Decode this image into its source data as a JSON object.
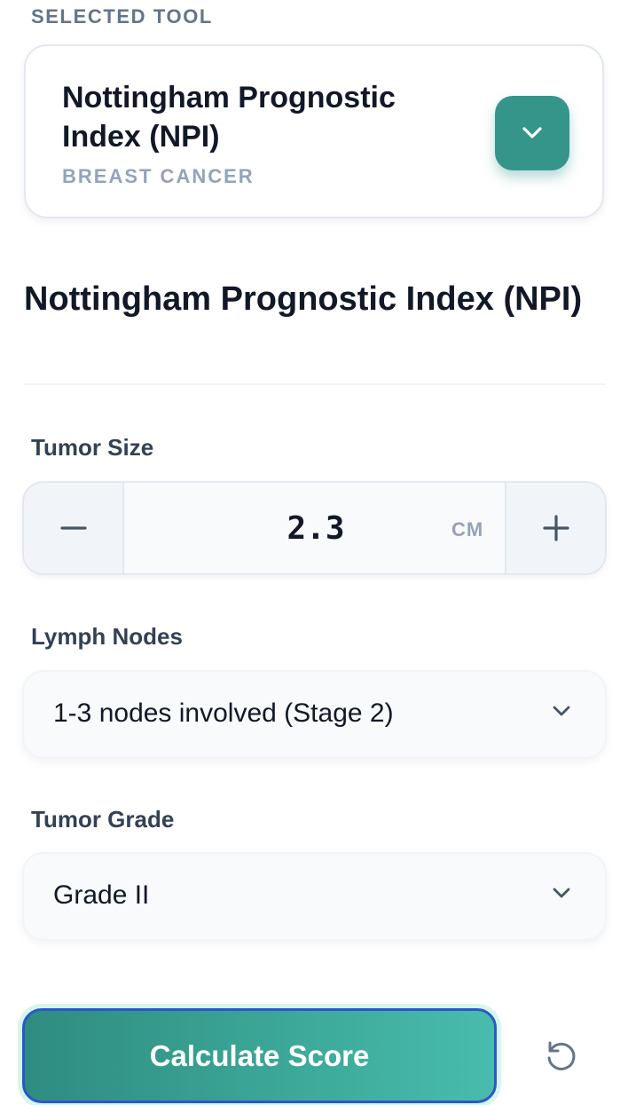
{
  "selected_tool": {
    "section_label": "SELECTED TOOL",
    "title": "Nottingham Prognostic Index (NPI)",
    "category": "BREAST CANCER",
    "toggle_icon": "chevron-down-icon"
  },
  "calculator": {
    "title": "Nottingham Prognostic Index (NPI)",
    "tumor_size": {
      "label": "Tumor Size",
      "value": "2.3",
      "unit": "CM",
      "decrement_icon": "minus-icon",
      "increment_icon": "plus-icon"
    },
    "lymph_nodes": {
      "label": "Lymph Nodes",
      "selected": "1-3 nodes involved (Stage 2)"
    },
    "tumor_grade": {
      "label": "Tumor Grade",
      "selected": "Grade II"
    },
    "calculate_label": "Calculate Score",
    "reset_icon": "reset-icon"
  },
  "colors": {
    "accent": "#35958a",
    "button_gradient_start": "#2f8c80",
    "button_gradient_end": "#48bcad",
    "focus_border": "#2c57c9",
    "muted_text": "#94a3b8",
    "label_text": "#334155"
  }
}
